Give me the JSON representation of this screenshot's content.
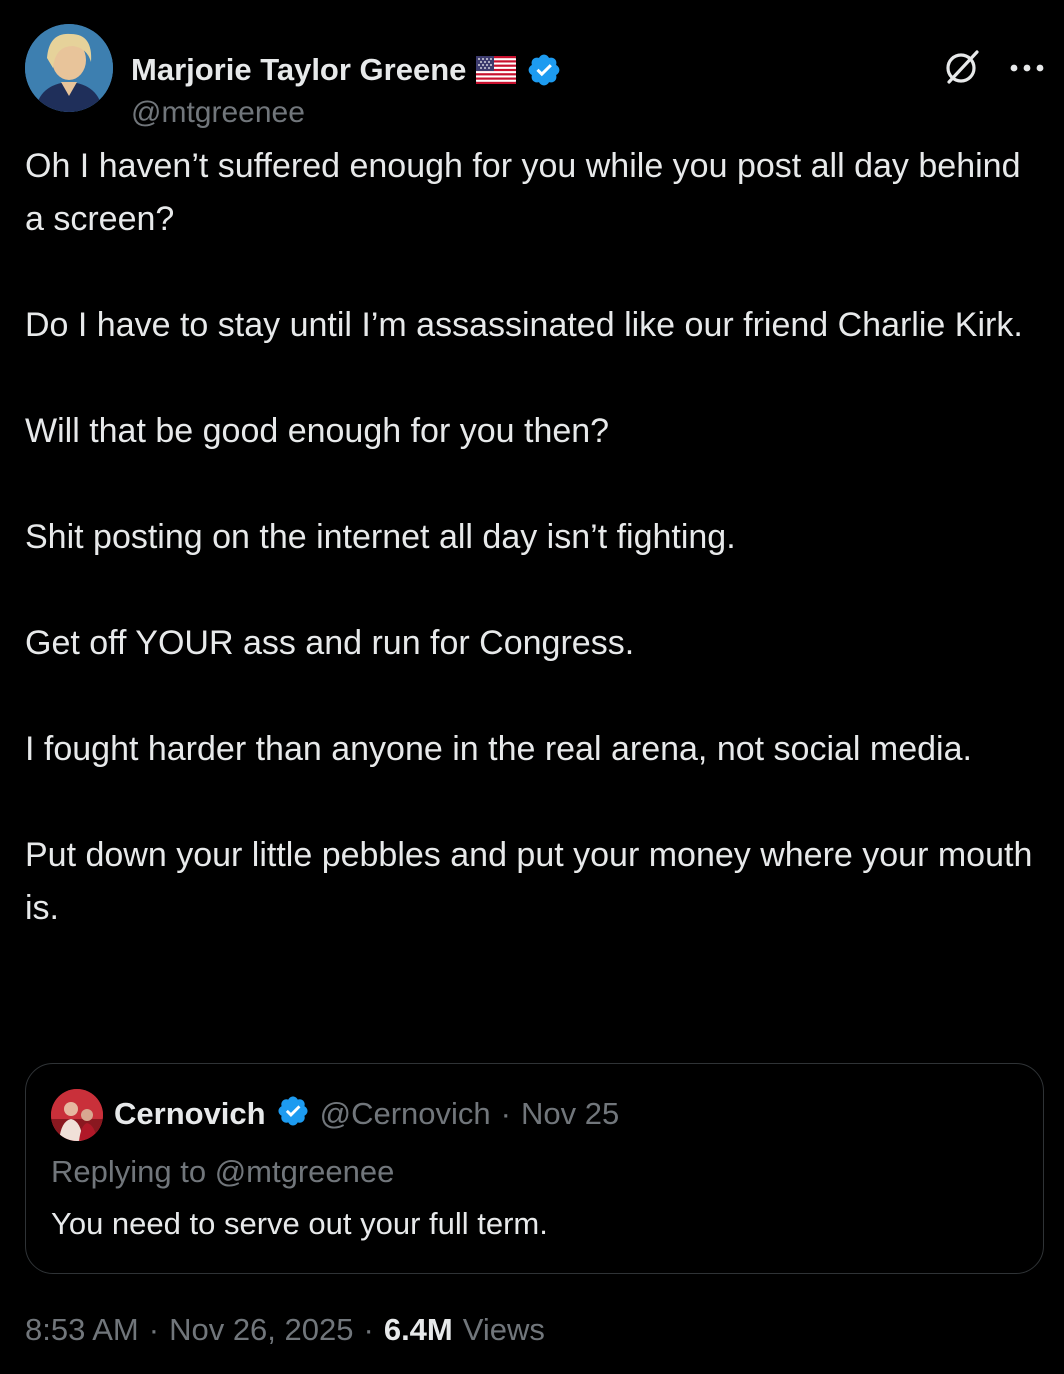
{
  "author": {
    "name": "Marjorie Taylor Greene",
    "handle": "@mtgreenee",
    "flag_icon": "us-flag-icon",
    "verified_icon": "verified-badge-icon",
    "verified_color": "#1d9bf0"
  },
  "top_icons": {
    "grok": "grok-icon",
    "more": "more-options-icon"
  },
  "tweet": {
    "paragraphs": [
      "Oh I haven’t suffered enough for you while you post all day behind a screen?",
      "Do I have to stay until I’m assassinated like our friend Charlie Kirk.",
      "Will that be good enough for you then?",
      "Shit posting on the internet all day isn’t fighting.",
      "Get off YOUR ass and run for Congress.",
      "I fought harder than anyone in the real arena, not social media.",
      "Put down your little pebbles and put your money where your mouth is."
    ]
  },
  "quoted": {
    "name": "Cernovich",
    "handle": "@Cernovich",
    "separator": "·",
    "date": "Nov 25",
    "replying_to": "Replying to @mtgreenee",
    "text": "You need to serve out your full term."
  },
  "meta": {
    "time": "8:53 AM",
    "sep1": "·",
    "date": "Nov 26, 2025",
    "sep2": "·",
    "views_count": "6.4M",
    "views_label": "Views"
  },
  "colors": {
    "background": "#000000",
    "text": "#e7e9ea",
    "muted": "#71767b",
    "border": "#2f3336",
    "accent": "#1d9bf0"
  }
}
